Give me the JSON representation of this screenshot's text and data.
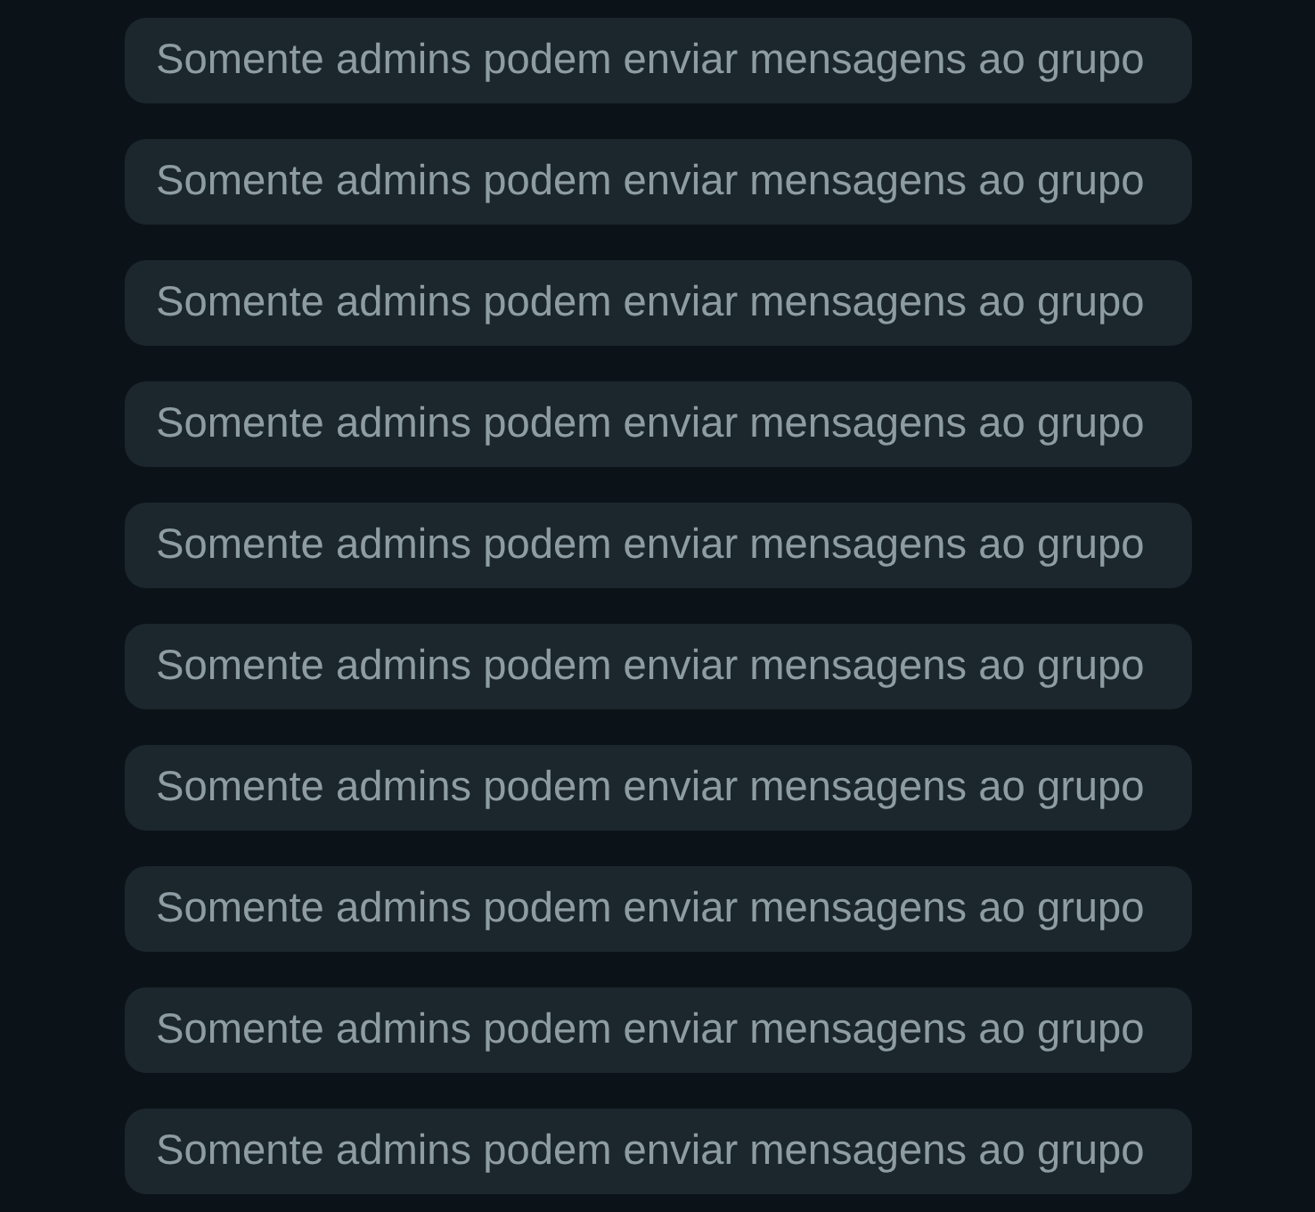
{
  "chat": {
    "system_messages": [
      {
        "text": "Somente admins podem enviar mensagens ao grupo"
      },
      {
        "text": "Somente admins podem enviar mensagens ao grupo"
      },
      {
        "text": "Somente admins podem enviar mensagens ao grupo"
      },
      {
        "text": "Somente admins podem enviar mensagens ao grupo"
      },
      {
        "text": "Somente admins podem enviar mensagens ao grupo"
      },
      {
        "text": "Somente admins podem enviar mensagens ao grupo"
      },
      {
        "text": "Somente admins podem enviar mensagens ao grupo"
      },
      {
        "text": "Somente admins podem enviar mensagens ao grupo"
      },
      {
        "text": "Somente admins podem enviar mensagens ao grupo"
      },
      {
        "text": "Somente admins podem enviar mensagens ao grupo"
      }
    ]
  }
}
